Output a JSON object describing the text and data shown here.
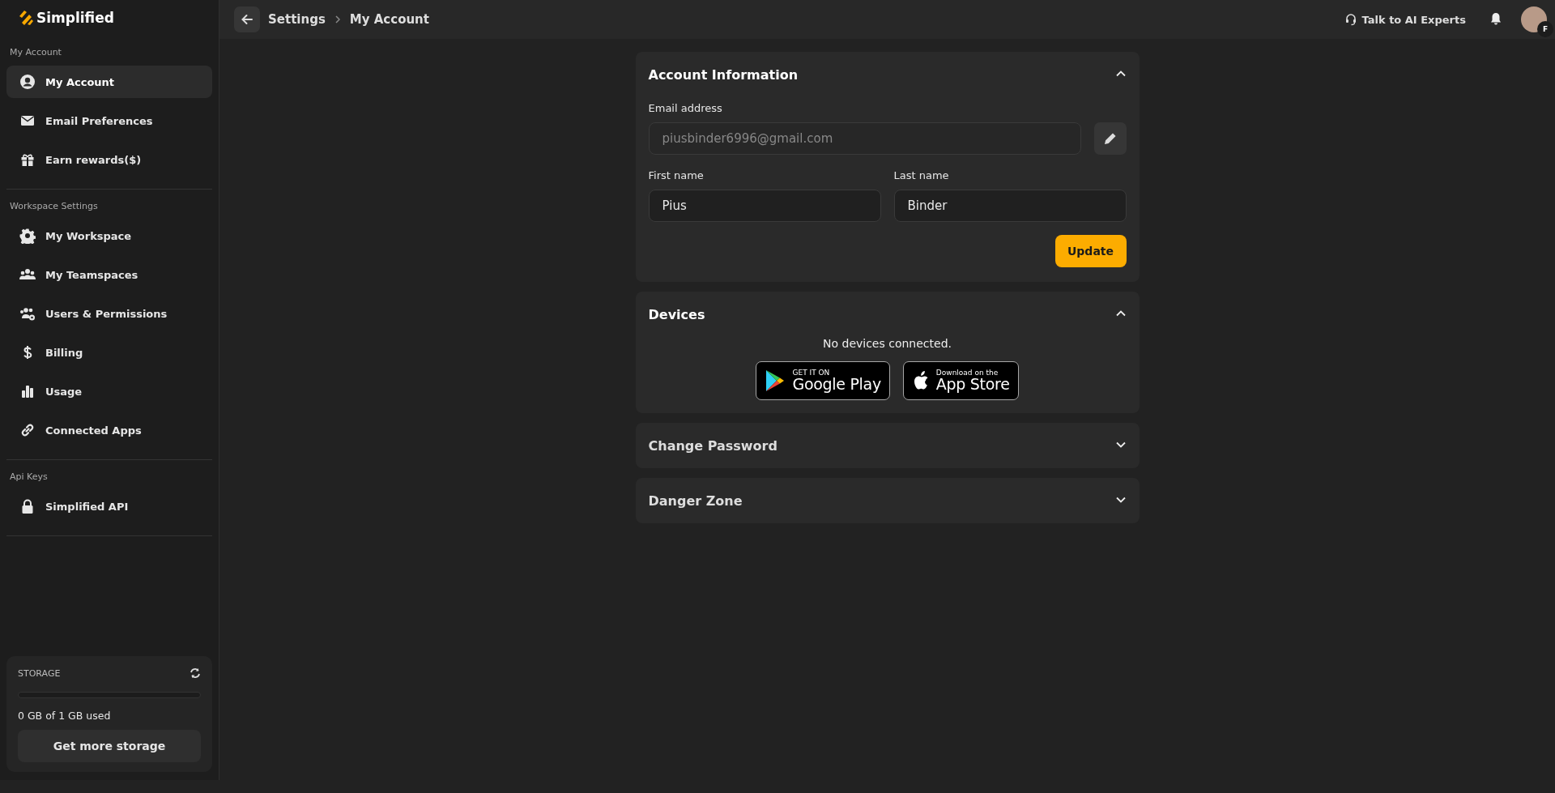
{
  "sidebar": {
    "logo": "Simplified",
    "groups": [
      {
        "title": "My Account",
        "items": [
          {
            "label": "My Account",
            "selected": true
          },
          {
            "label": "Email Preferences",
            "selected": false
          },
          {
            "label": "Earn rewards($)",
            "selected": false
          }
        ]
      },
      {
        "title": "Workspace Settings",
        "items": [
          {
            "label": "My Workspace",
            "selected": false
          },
          {
            "label": "My Teamspaces",
            "selected": false
          },
          {
            "label": "Users & Permissions",
            "selected": false
          },
          {
            "label": "Billing",
            "selected": false
          },
          {
            "label": "Usage",
            "selected": false
          },
          {
            "label": "Connected Apps",
            "selected": false
          }
        ]
      },
      {
        "title": "Api Keys",
        "items": [
          {
            "label": "Simplified API",
            "selected": false
          }
        ]
      }
    ],
    "storage": {
      "title": "STORAGE",
      "level": 0,
      "usage": "0 GB of 1 GB used",
      "button": "Get more storage"
    }
  },
  "topbar": {
    "breadcrumb": [
      "Settings",
      "My Account"
    ],
    "support": "Talk to AI Experts",
    "avatar_badge": "F"
  },
  "sections": [
    {
      "kind": "account",
      "title": "Account Information",
      "expanded": true,
      "email_label": "Email address",
      "email_value": "piusbinder6996@gmail.com",
      "first_label": "First name",
      "first_value": "Pius",
      "last_label": "Last name",
      "last_value": "Binder",
      "button": "Update"
    },
    {
      "kind": "devices",
      "title": "Devices",
      "expanded": true,
      "message": "No devices connected.",
      "stores": [
        {
          "top": "GET IT ON",
          "name": "Google Play"
        },
        {
          "top": "Download on the",
          "name": "App Store"
        }
      ]
    },
    {
      "kind": "password",
      "title": "Change Password",
      "expanded": false
    },
    {
      "kind": "danger",
      "title": "Danger Zone",
      "expanded": false
    }
  ]
}
